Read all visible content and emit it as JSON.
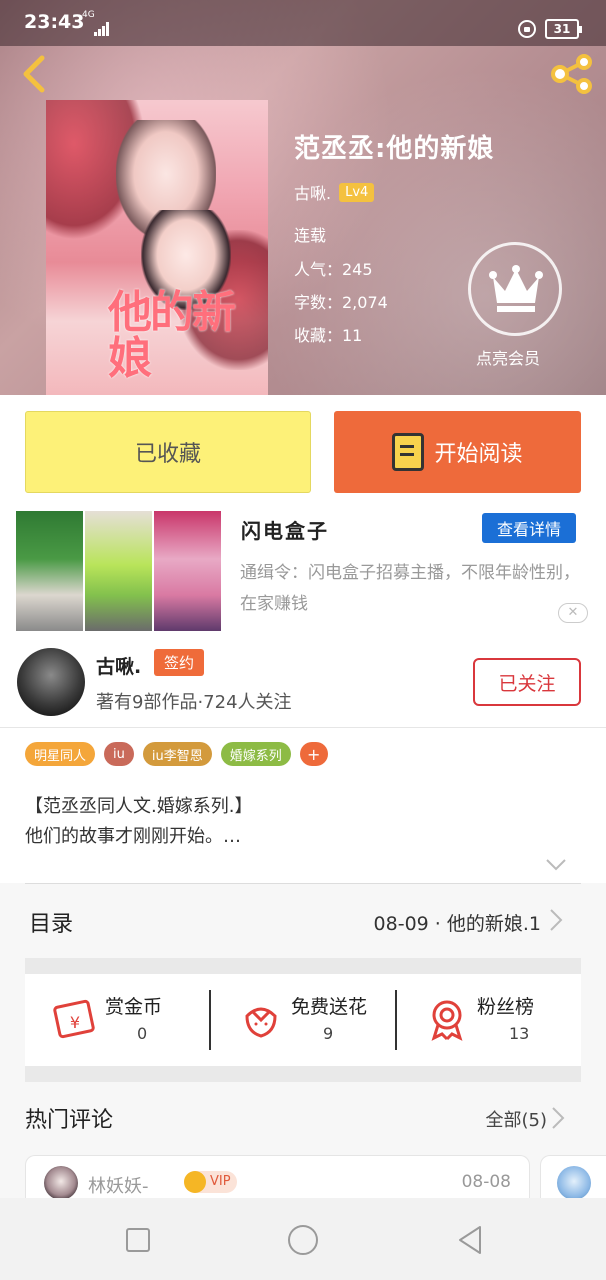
{
  "status_bar": {
    "time": "23:43",
    "network": "4G",
    "battery": "31"
  },
  "book": {
    "title": "范丞丞:他的新娘",
    "author": "古啾.",
    "level": "Lv4",
    "status": "连载",
    "popularity": "人气：245",
    "word_count": "字数：2,074",
    "favorites": "收藏：11",
    "cover_title": "他的新娘"
  },
  "vip": {
    "label": "点亮会员",
    "icon": "crown-icon"
  },
  "actions": {
    "collected_label": "已收藏",
    "read_label": "开始阅读"
  },
  "ad": {
    "title": "闪电盒子",
    "detail_label": "查看详情",
    "description": "通缉令：闪电盒子招募主播，不限年龄性别，在家赚钱",
    "close_label": "✕"
  },
  "author_row": {
    "name": "古啾.",
    "badge": "签约",
    "info": "著有9部作品·724人关注",
    "follow_label": "已关注"
  },
  "tags": [
    {
      "label": "明星同人",
      "color": "#f4a63a"
    },
    {
      "label": "iu",
      "color": "#c96a5a"
    },
    {
      "label": "iu李智恩",
      "color": "#d39a3c"
    },
    {
      "label": "婚嫁系列",
      "color": "#8dbb45"
    },
    {
      "label": "+",
      "color": "#ee6a3b"
    }
  ],
  "intro": {
    "line1": "【范丞丞同人文.婚嫁系列.】",
    "line2": "他们的故事才刚刚开始。…"
  },
  "catalogue": {
    "label": "目录",
    "latest": "08-09 · 他的新娘.1"
  },
  "stats": [
    {
      "label": "赏金币",
      "value": "0",
      "icon": "red-envelope-icon"
    },
    {
      "label": "免费送花",
      "value": "9",
      "icon": "flower-icon"
    },
    {
      "label": "粉丝榜",
      "value": "13",
      "icon": "medal-icon"
    }
  ],
  "comments": {
    "title": "热门评论",
    "all_label": "全部(5)",
    "first": {
      "user": "林妖妖-",
      "vip": "VIP",
      "date": "08-08"
    }
  },
  "colors": {
    "accent": "#ee6a3b",
    "collected": "#fdf178",
    "detail_blue": "#1b6fd6",
    "follow_red": "#d9373c"
  }
}
